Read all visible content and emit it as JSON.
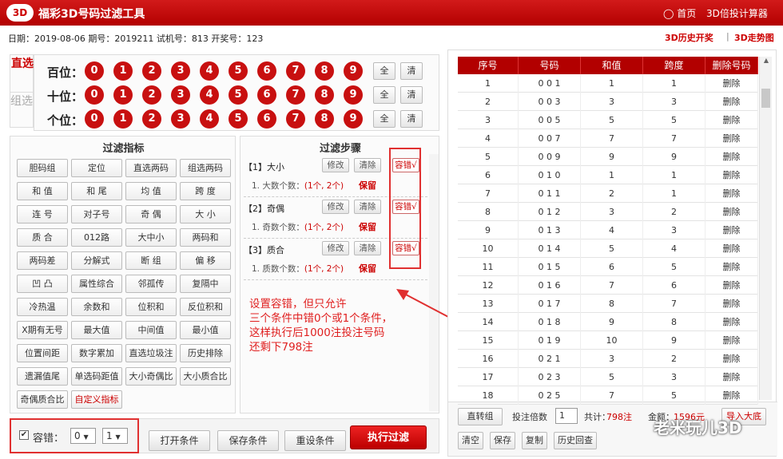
{
  "app": {
    "logo": "3D",
    "title": "福彩3D号码过滤工具",
    "nav_home": "首页",
    "nav_calc": "3D倍投计算器"
  },
  "info": {
    "text": "日期：2019-08-06 期号：2019211 试机号：813 开奖号：123",
    "link_history": "3D历史开奖",
    "link_sep": "|",
    "link_trend": "3D走势图"
  },
  "mode": {
    "direct": "直选",
    "group": "组选"
  },
  "digits": {
    "rows": [
      "百位：",
      "十位：",
      "个位："
    ],
    "balls": [
      "0",
      "1",
      "2",
      "3",
      "4",
      "5",
      "6",
      "7",
      "8",
      "9"
    ],
    "all": "全",
    "clear": "清"
  },
  "indicators": {
    "title": "过滤指标",
    "buttons": [
      "胆码组",
      "定位",
      "直选两码",
      "组选两码",
      "和 值",
      "和 尾",
      "均 值",
      "跨 度",
      "连 号",
      "对子号",
      "奇 偶",
      "大 小",
      "质 合",
      "012路",
      "大中小",
      "两码和",
      "两码差",
      "分解式",
      "断 组",
      "偏 移",
      "凹 凸",
      "属性综合",
      "邻孤传",
      "复隔中",
      "冷热温",
      "余数和",
      "位积和",
      "反位积和",
      "X期有无号",
      "最大值",
      "中间值",
      "最小值",
      "位置间距",
      "数字累加",
      "直选垃圾注",
      "历史排除",
      "遗漏值尾",
      "单选码距值",
      "大小奇偶比",
      "大小质合比",
      "奇偶质合比",
      "自定义指标"
    ]
  },
  "steps": {
    "title": "过滤步骤",
    "modify": "修改",
    "clear": "清除",
    "tolerance": "容错√",
    "keep": "保留",
    "items": [
      {
        "name": "【1】大小",
        "desc_label": "1. 大数个数：",
        "desc_value": "(1个, 2个)"
      },
      {
        "name": "【2】奇偶",
        "desc_label": "1. 奇数个数：",
        "desc_value": "(1个, 2个)"
      },
      {
        "name": "【3】质合",
        "desc_label": "1. 质数个数：",
        "desc_value": "(1个, 2个)"
      }
    ]
  },
  "annotation": [
    "设置容错，但只允许",
    "三个条件中错0个或1个条件，",
    "这样执行后1000注投注号码",
    "还剩下798注"
  ],
  "bottom": {
    "tol_label": "容错：",
    "tol_from": "0",
    "tol_to": "1",
    "open": "打开条件",
    "save": "保存条件",
    "reset": "重设条件",
    "run": "执行过滤"
  },
  "table": {
    "headers": [
      "序号",
      "号码",
      "和值",
      "跨度",
      "删除号码"
    ],
    "rows": [
      [
        "1",
        "0 0 1",
        "1",
        "1",
        "删除"
      ],
      [
        "2",
        "0 0 3",
        "3",
        "3",
        "删除"
      ],
      [
        "3",
        "0 0 5",
        "5",
        "5",
        "删除"
      ],
      [
        "4",
        "0 0 7",
        "7",
        "7",
        "删除"
      ],
      [
        "5",
        "0 0 9",
        "9",
        "9",
        "删除"
      ],
      [
        "6",
        "0 1 0",
        "1",
        "1",
        "删除"
      ],
      [
        "7",
        "0 1 1",
        "2",
        "1",
        "删除"
      ],
      [
        "8",
        "0 1 2",
        "3",
        "2",
        "删除"
      ],
      [
        "9",
        "0 1 3",
        "4",
        "3",
        "删除"
      ],
      [
        "10",
        "0 1 4",
        "5",
        "4",
        "删除"
      ],
      [
        "11",
        "0 1 5",
        "6",
        "5",
        "删除"
      ],
      [
        "12",
        "0 1 6",
        "7",
        "6",
        "删除"
      ],
      [
        "13",
        "0 1 7",
        "8",
        "7",
        "删除"
      ],
      [
        "14",
        "0 1 8",
        "9",
        "8",
        "删除"
      ],
      [
        "15",
        "0 1 9",
        "10",
        "9",
        "删除"
      ],
      [
        "16",
        "0 2 1",
        "3",
        "2",
        "删除"
      ],
      [
        "17",
        "0 2 3",
        "5",
        "3",
        "删除"
      ],
      [
        "18",
        "0 2 5",
        "7",
        "5",
        "删除"
      ]
    ],
    "footer": {
      "to_group": "直转组",
      "multiple_label": "投注倍数",
      "multiple": "1",
      "total_label": "共计：",
      "total": "798注",
      "amount_label": "金额：",
      "amount": "1596元",
      "import": "导入大底",
      "empty": "清空",
      "save": "保存",
      "copy": "复制",
      "history": "历史回查"
    }
  },
  "watermark": "老米玩儿3D",
  "colors": {
    "brand": "#b20000",
    "annotation": "#e02020"
  }
}
